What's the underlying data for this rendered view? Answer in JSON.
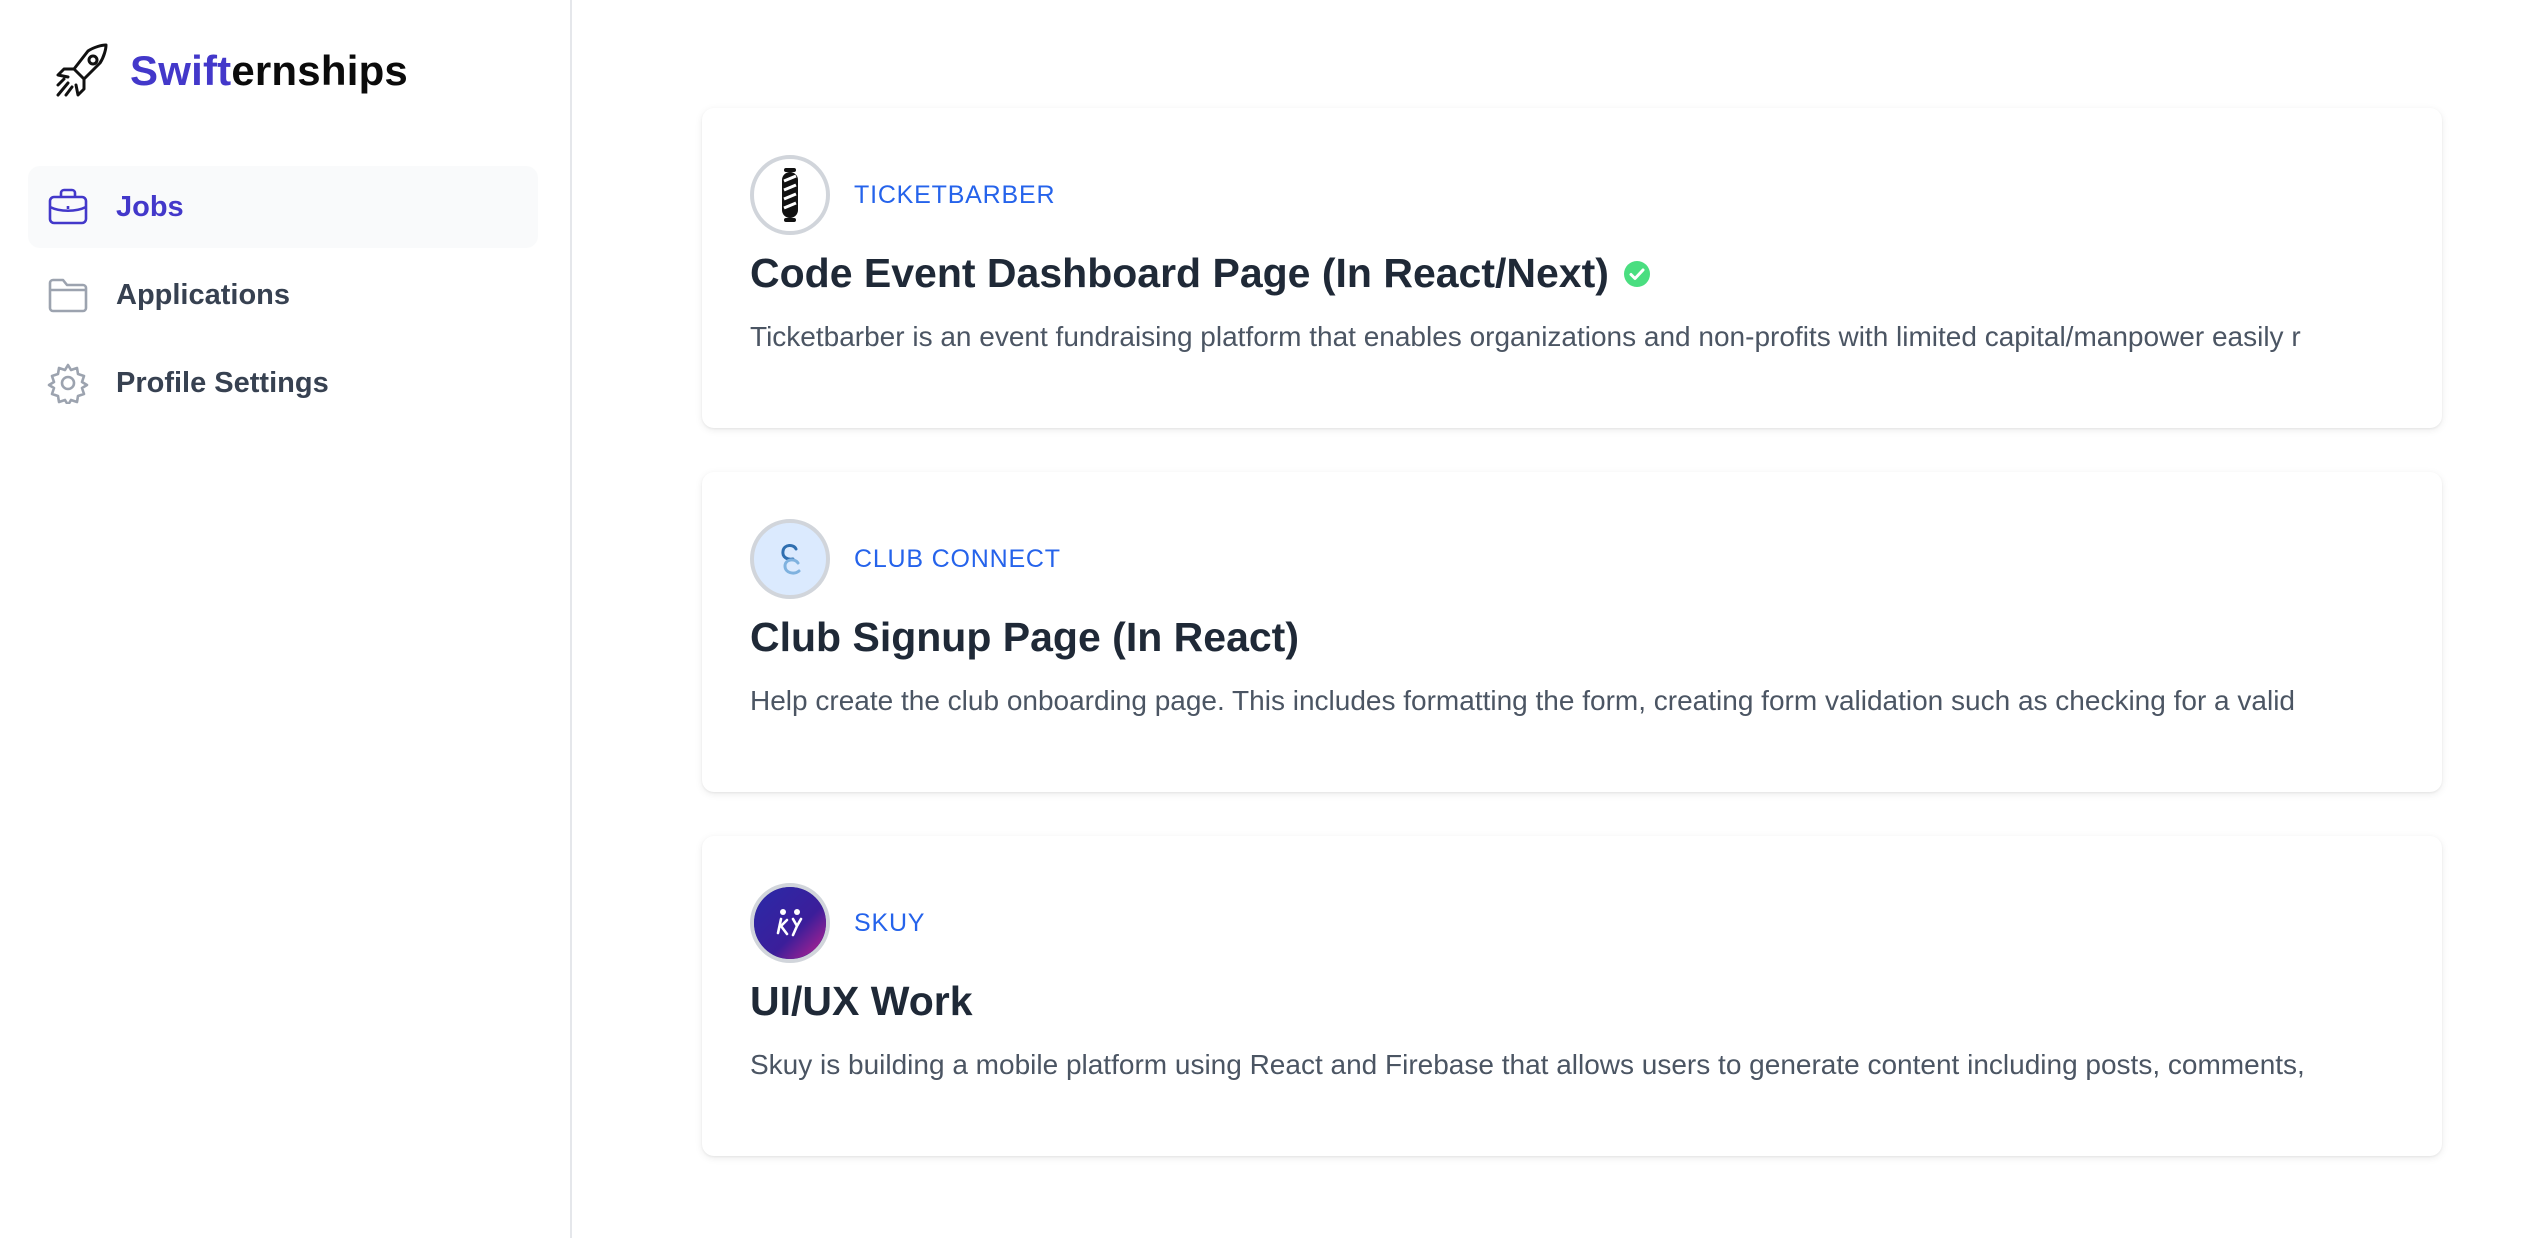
{
  "brand": {
    "name_part1": "Swift",
    "name_part2": "ernships",
    "icon": "rocket-icon"
  },
  "sidebar": {
    "items": [
      {
        "label": "Jobs",
        "icon": "briefcase-icon",
        "active": true
      },
      {
        "label": "Applications",
        "icon": "folder-icon",
        "active": false
      },
      {
        "label": "Profile Settings",
        "icon": "gear-icon",
        "active": false
      }
    ]
  },
  "colors": {
    "accent": "#4338ca",
    "company": "#2563eb",
    "verified": "#4ade80"
  },
  "jobs": [
    {
      "company": "TICKETBARBER",
      "logo": "barber-pole-logo",
      "title": "Code Event Dashboard Page (In React/Next)",
      "verified": true,
      "description": "Ticketbarber is an event fundraising platform that enables organizations and non-profits with limited capital/manpower easily r"
    },
    {
      "company": "CLUB CONNECT",
      "logo": "club-connect-logo",
      "title": "Club Signup Page (In React)",
      "verified": false,
      "description": "Help create the club onboarding page. This includes formatting the form, creating form validation such as checking for a valid"
    },
    {
      "company": "SKUY",
      "logo": "skuy-logo",
      "title": "UI/UX Work",
      "verified": false,
      "description": "Skuy is building a mobile platform using React and Firebase that allows users to generate content including posts, comments,"
    }
  ]
}
